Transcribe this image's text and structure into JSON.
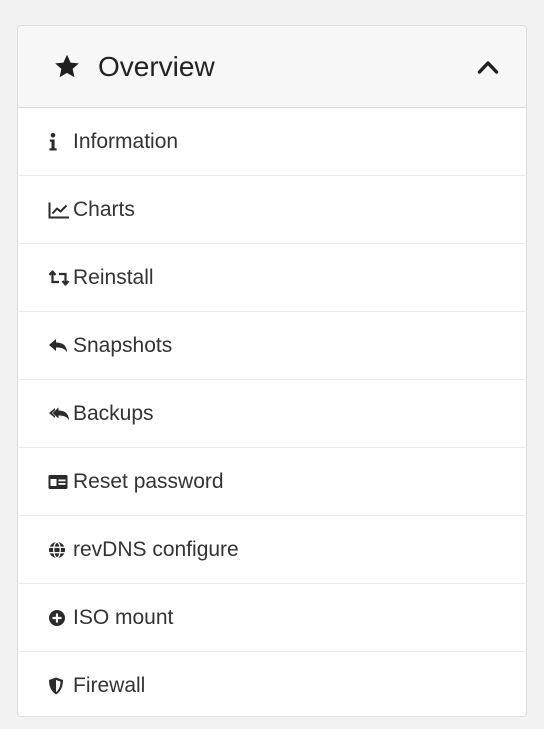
{
  "panel": {
    "title": "Overview",
    "title_icon": "star-icon",
    "collapse_icon": "chevron-up-icon",
    "expanded": true
  },
  "menu": {
    "items": [
      {
        "label": "Information",
        "icon": "info-icon"
      },
      {
        "label": "Charts",
        "icon": "line-chart-icon"
      },
      {
        "label": "Reinstall",
        "icon": "retweet-icon"
      },
      {
        "label": "Snapshots",
        "icon": "reply-icon"
      },
      {
        "label": "Backups",
        "icon": "reply-all-icon"
      },
      {
        "label": "Reset password",
        "icon": "id-card-icon"
      },
      {
        "label": "revDNS configure",
        "icon": "globe-icon"
      },
      {
        "label": "ISO mount",
        "icon": "plus-circle-icon"
      },
      {
        "label": "Firewall",
        "icon": "shield-icon"
      }
    ]
  },
  "colors": {
    "background": "#f2f2f2",
    "header_background": "#f7f7f7",
    "text": "#333333",
    "icon": "#2b2b2b"
  }
}
